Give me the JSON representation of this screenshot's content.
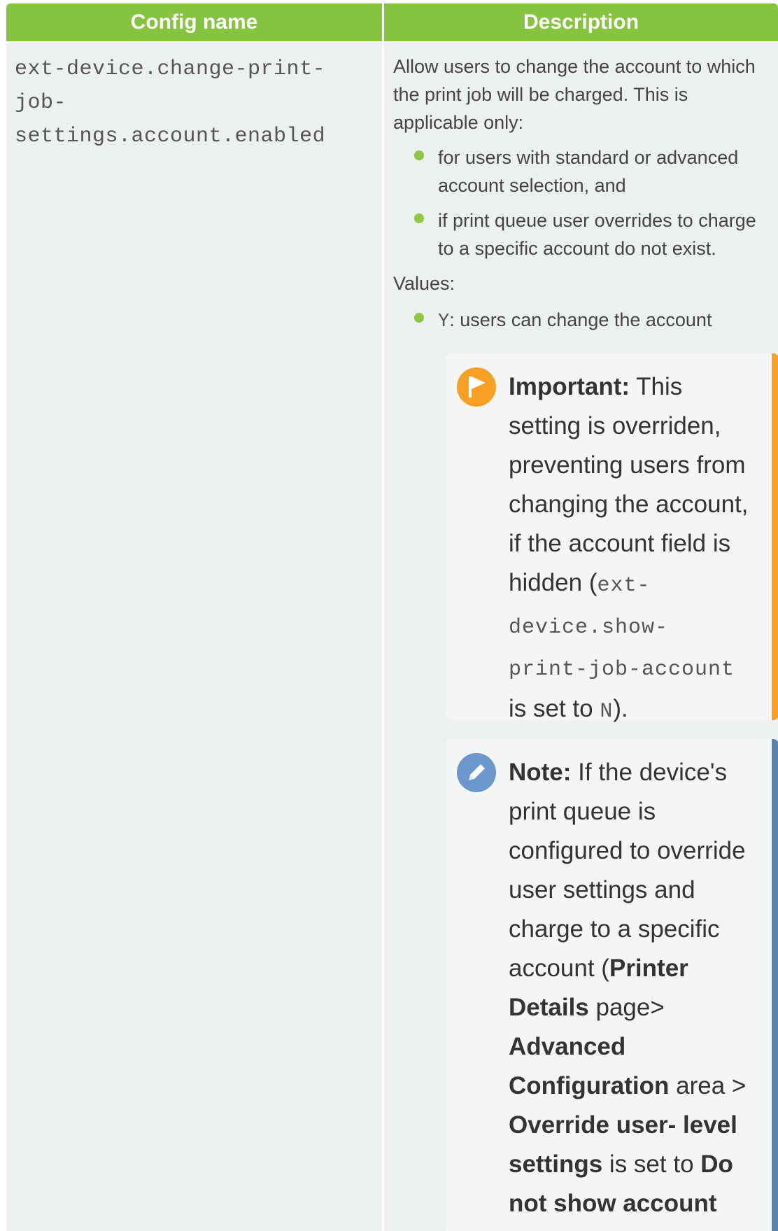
{
  "headers": {
    "config_name": "Config name",
    "description": "Description"
  },
  "row": {
    "config_name_parts": [
      "ext-device.change-print-",
      "job-",
      "settings.account.enabled"
    ],
    "description": {
      "intro": "Allow users to change the account to which the print job will be charged. This is applicable only:",
      "conditions": [
        "for users with standard or advanced account selection, and",
        "if print queue user overrides to charge to a specific account do not exist."
      ],
      "values_label": "Values:",
      "values": [
        {
          "code": "Y",
          "text": ": users can change the account"
        }
      ]
    },
    "important": {
      "label": "Important:",
      "text1": " This setting is overriden, preventing users from changing the account, if the account field is hidden (",
      "code1a": "ext-",
      "code1b": "device.show-",
      "code1c": "print-job-account",
      "text2": " is set to ",
      "code2": "N",
      "text3": ")."
    },
    "note": {
      "label": "Note:",
      "text1": " If the device's print queue is configured to override user settings and charge to a specific account (",
      "b1": "Printer Details",
      "text2": " page> ",
      "b2": "Advanced Configuration",
      "text3": " area > ",
      "b3": "Override user- level settings",
      "text4": " is set to ",
      "b4": "Do not show account"
    }
  },
  "colors": {
    "header_green": "#86c440",
    "bullet_green": "#8dc63f",
    "important_orange": "#f7a024",
    "note_blue": "#5a82b0",
    "cell_bg": "#ecf0f1"
  },
  "icons": {
    "important": "flag-icon",
    "note": "pencil-icon"
  }
}
